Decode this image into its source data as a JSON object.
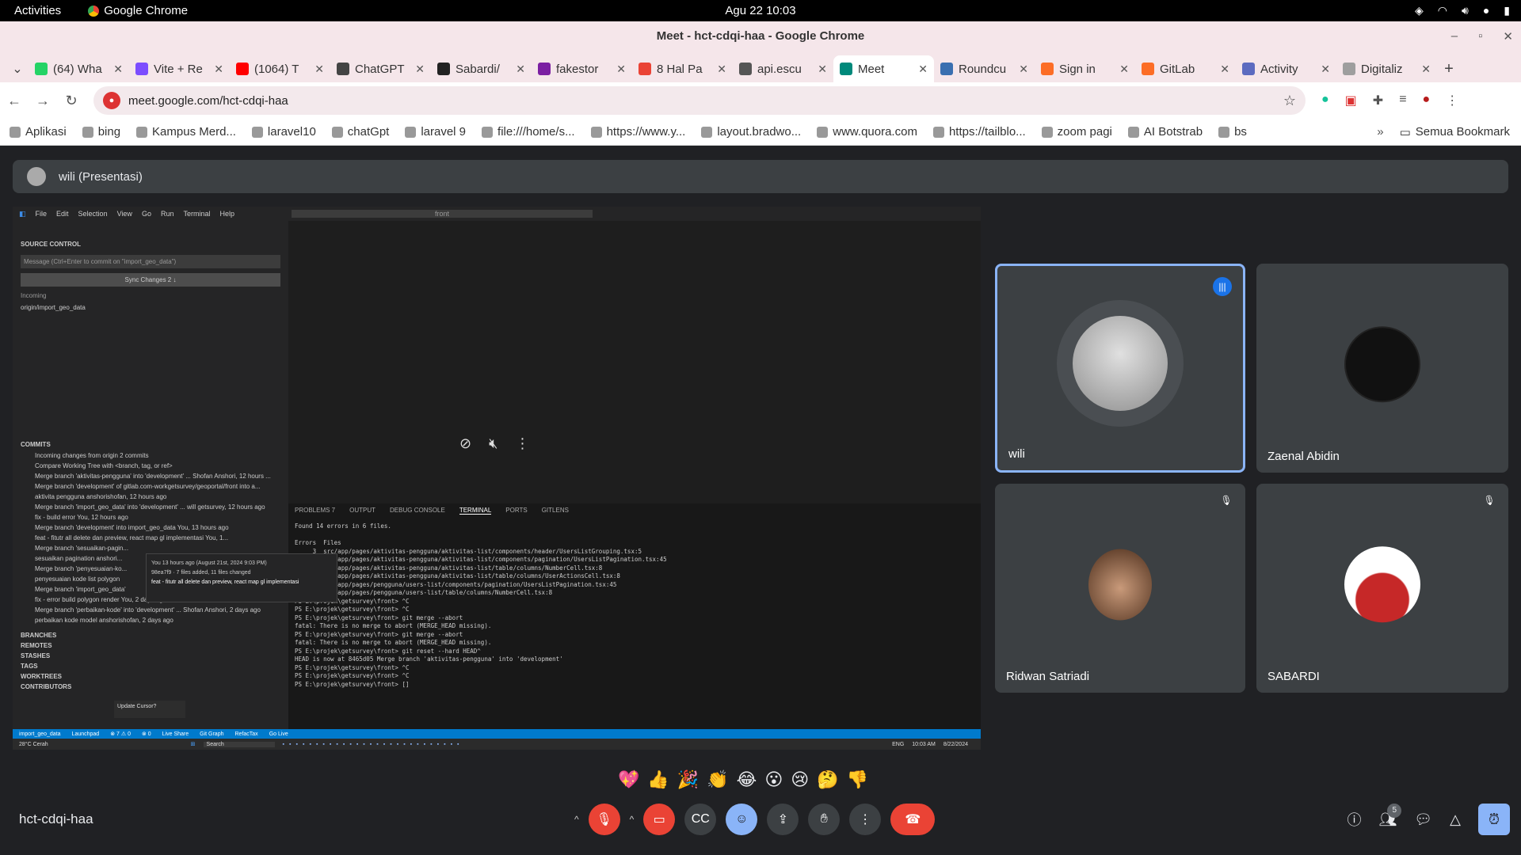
{
  "system_bar": {
    "activities": "Activities",
    "app_name": "Google Chrome",
    "datetime": "Agu 22  10:03"
  },
  "window": {
    "title": "Meet - hct-cdqi-haa - Google Chrome"
  },
  "tabs": [
    {
      "label": "(64) Wha",
      "color": "#25d366"
    },
    {
      "label": "Vite + Re",
      "color": "#7c4dff"
    },
    {
      "label": "(1064) T",
      "color": "#ff0000"
    },
    {
      "label": "ChatGPT",
      "color": "#444444"
    },
    {
      "label": "Sabardi/",
      "color": "#222222"
    },
    {
      "label": "fakestor",
      "color": "#7b1fa2"
    },
    {
      "label": "8 Hal Pa",
      "color": "#ea4335"
    },
    {
      "label": "api.escu",
      "color": "#555555"
    },
    {
      "label": "Meet",
      "color": "#00897b"
    },
    {
      "label": "Roundcu",
      "color": "#3a6fb0"
    },
    {
      "label": "Sign in",
      "color": "#fc6d26"
    },
    {
      "label": "GitLab",
      "color": "#fc6d26"
    },
    {
      "label": "Activity",
      "color": "#5c6bc0"
    },
    {
      "label": "Digitaliz",
      "color": "#9e9e9e"
    }
  ],
  "address_bar": {
    "url": "meet.google.com/hct-cdqi-haa"
  },
  "bookmarks": [
    "Aplikasi",
    "bing",
    "Kampus Merd...",
    "laravel10",
    "chatGpt",
    "laravel 9",
    "file:///home/s...",
    "https://www.y...",
    "layout.bradwo...",
    "www.quora.com",
    "https://tailblo...",
    "zoom pagi",
    "AI Botstrab",
    "bs"
  ],
  "all_bookmarks": "Semua Bookmark",
  "meet": {
    "presenter_label": "wili (Presentasi)",
    "meeting_code": "hct-cdqi-haa",
    "participant_count": "5",
    "participants": [
      {
        "name": "wili",
        "muted": false,
        "speaking": true
      },
      {
        "name": "Zaenal Abidin",
        "muted": false,
        "speaking": false
      },
      {
        "name": "Ridwan Satriadi",
        "muted": true,
        "speaking": false
      },
      {
        "name": "SABARDI",
        "muted": true,
        "speaking": false
      }
    ],
    "reactions": [
      "💖",
      "👍",
      "🎉",
      "👏",
      "😂",
      "😮",
      "😢",
      "🤔",
      "👎"
    ]
  },
  "shared_screen": {
    "menu": [
      "File",
      "Edit",
      "Selection",
      "View",
      "Go",
      "Run",
      "Terminal",
      "Help"
    ],
    "search": "front",
    "source_control_title": "SOURCE CONTROL",
    "commit_placeholder": "Message (Ctrl+Enter to commit on \"import_geo_data\")",
    "sync_label": "Sync Changes 2 ↓",
    "incoming_label": "Incoming",
    "incoming_branch": "origin/import_geo_data",
    "commits_title": "COMMITS",
    "commit_lines": [
      "Incoming changes from origin  2 commits",
      "Compare Working Tree with <branch, tag, or ref>",
      "Merge branch 'aktivitas-pengguna' into 'development' ... Shofan Anshori, 12 hours ...",
      "Merge branch 'development' of gitlab.com-workgetsurvey/geoportal/front into a...",
      "aktivita pengguna  anshorishofan, 12 hours ago",
      "Merge branch 'import_geo_data' into 'development' ... will getsurvey, 12 hours ago",
      "fix - build error  You, 12 hours ago",
      "Merge branch 'development' into import_geo_data  You, 13 hours ago",
      "feat - fitutr all delete dan preview, react map gl implementasi  You, 1...",
      "Merge branch 'sesuaikan-pagin...",
      "sesuaikan pagination  anshori...",
      "Merge branch 'penyesuaian-ko...",
      "penyesuaian kode list polygon",
      "Merge branch 'import_geo_data'",
      "fix - error build polygon render  You, 2 days ago",
      "Merge branch 'perbaikan-kode' into 'development' ... Shofan Anshori, 2 days ago",
      "perbaikan kode model  anshorishofan, 2 days ago"
    ],
    "side_sections": [
      "BRANCHES",
      "REMOTES",
      "STASHES",
      "TAGS",
      "WORKTREES",
      "CONTRIBUTORS"
    ],
    "popup_lines": [
      "You  13 hours ago (August 21st, 2024 9:03 PM)",
      "98ea7f9 · 7 files added, 11 files changed",
      "feat - fitutr all delete dan preview, react map gl implementasi"
    ],
    "update_cursor": "Update Cursor?",
    "terminal_tabs": [
      "PROBLEMS 7",
      "OUTPUT",
      "DEBUG CONSOLE",
      "TERMINAL",
      "PORTS",
      "GITLENS"
    ],
    "terminal_lines": [
      "Found 14 errors in 6 files.",
      "",
      "Errors  Files",
      "     3  src/app/pages/aktivitas-pengguna/aktivitas-list/components/header/UsersListGrouping.tsx:5",
      "     1  src/app/pages/aktivitas-pengguna/aktivitas-list/components/pagination/UsersListPagination.tsx:45",
      "     1  src/app/pages/aktivitas-pengguna/aktivitas-list/table/columns/NumberCell.tsx:8",
      "     1  src/app/pages/aktivitas-pengguna/aktivitas-list/table/columns/UserActionsCell.tsx:8",
      "     3  src/app/pages/pengguna/users-list/components/pagination/UsersListPagination.tsx:45",
      "     1  src/app/pages/pengguna/users-list/table/columns/NumberCell.tsx:8",
      "PS E:\\projek\\getsurvey\\front> ^C",
      "PS E:\\projek\\getsurvey\\front> ^C",
      "PS E:\\projek\\getsurvey\\front> git merge --abort",
      "fatal: There is no merge to abort (MERGE_HEAD missing).",
      "PS E:\\projek\\getsurvey\\front> git merge --abort",
      "fatal: There is no merge to abort (MERGE_HEAD missing).",
      "PS E:\\projek\\getsurvey\\front> git reset --hard HEAD^",
      "HEAD is now at 8465d05 Merge branch 'aktivitas-pengguna' into 'development'",
      "PS E:\\projek\\getsurvey\\front> ^C",
      "PS E:\\projek\\getsurvey\\front> ^C",
      "PS E:\\projek\\getsurvey\\front> []"
    ],
    "status_items": [
      "import_geo_data",
      "Launchpad",
      "⊗ 7 ⚠ 0",
      "⊗ 0",
      "Live Share",
      "Git Graph",
      "RefacTax",
      "Go Live"
    ],
    "taskbar_weather": "28°C Cerah",
    "taskbar_search": "Search",
    "taskbar_lang": "ENG",
    "taskbar_time": "10:03 AM",
    "taskbar_date": "8/22/2024"
  }
}
